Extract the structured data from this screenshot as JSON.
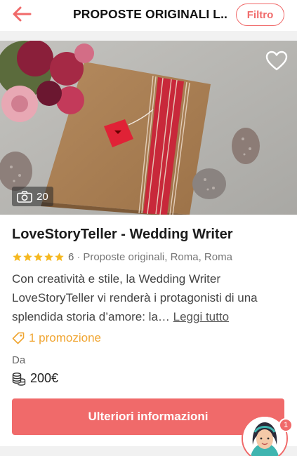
{
  "header": {
    "title": "PROPOSTE ORIGINALI L...",
    "filter_label": "Filtro",
    "back_icon": "arrow-left-icon",
    "accent_color": "#f06a6a"
  },
  "listing": {
    "photo_count": "20",
    "favorite_icon": "heart-icon",
    "camera_icon": "camera-icon",
    "name": "LoveStoryTeller - Wedding Writer",
    "rating_stars": 5,
    "rating_max": 5,
    "rating_count": "6",
    "rating_separator": "·",
    "category_location": "Proposte originali, Roma, Roma",
    "description": "Con creatività e stile, la Wedding Writer LoveStoryTeller vi renderà i protagonisti di una splendida storia d’amore: la…",
    "read_more": "Leggi tutto",
    "promo_icon": "tag-icon",
    "promo_text": "1 promozione",
    "promo_color": "#f0a531",
    "price_label": "Da",
    "price_icon": "coins-icon",
    "price_value": "200€",
    "cta_label": "Ulteriori informazioni"
  },
  "assistant": {
    "avatar_icon": "assistant-avatar-icon",
    "badge_count": "1"
  }
}
